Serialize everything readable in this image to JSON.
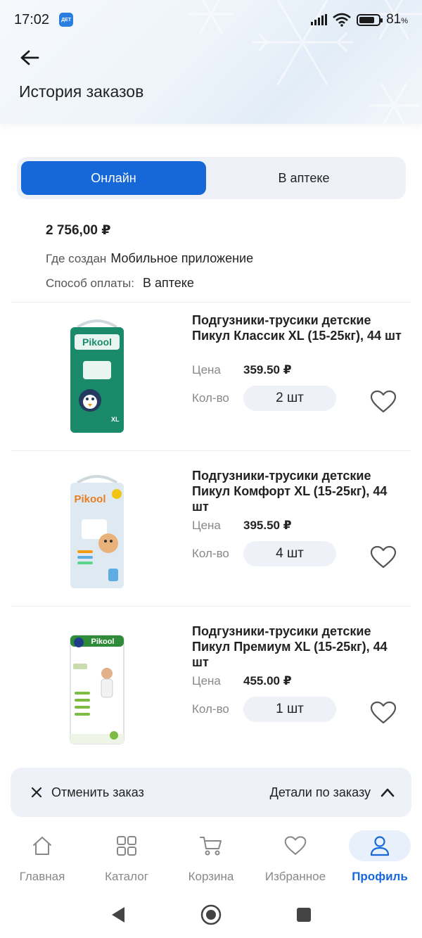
{
  "status_bar": {
    "time": "17:02",
    "app_badge": "ДЕТ",
    "battery_percent": "81",
    "battery_unit": "%"
  },
  "header": {
    "title": "История заказов"
  },
  "tabs": [
    {
      "label": "Онлайн",
      "active": true
    },
    {
      "label": "В аптеке",
      "active": false
    }
  ],
  "order": {
    "total": "2 756,00 ₽",
    "created_label": "Где создан",
    "created_value": "Мобильное приложение",
    "payment_label": "Способ оплаты:",
    "payment_value": "В аптеке"
  },
  "labels": {
    "price": "Цена",
    "qty": "Кол-во"
  },
  "products": [
    {
      "name": "Подгузники-трусики детские Пикул Классик XL (15-25кг), 44 шт",
      "price": "359.50 ₽",
      "qty": "2 шт",
      "brand": "Pikool",
      "color": "#1a8a6a"
    },
    {
      "name": "Подгузники-трусики детские Пикул Комфорт XL (15-25кг), 44 шт",
      "price": "395.50 ₽",
      "qty": "4 шт",
      "brand": "Pikool",
      "color": "#dfe9f1"
    },
    {
      "name": "Подгузники-трусики детские Пикул Премиум XL (15-25кг), 44 шт",
      "price": "455.00 ₽",
      "qty": "1 шт",
      "brand": "Pikool",
      "color": "#ffffff"
    }
  ],
  "actions": {
    "cancel": "Отменить заказ",
    "details": "Детали по заказу"
  },
  "bottom_nav": [
    {
      "label": "Главная",
      "icon": "home-icon"
    },
    {
      "label": "Каталог",
      "icon": "catalog-icon"
    },
    {
      "label": "Корзина",
      "icon": "cart-icon"
    },
    {
      "label": "Избранное",
      "icon": "heart-icon"
    },
    {
      "label": "Профиль",
      "icon": "profile-icon",
      "active": true
    }
  ],
  "colors": {
    "accent": "#1668d9",
    "surface": "#eef2f8"
  }
}
